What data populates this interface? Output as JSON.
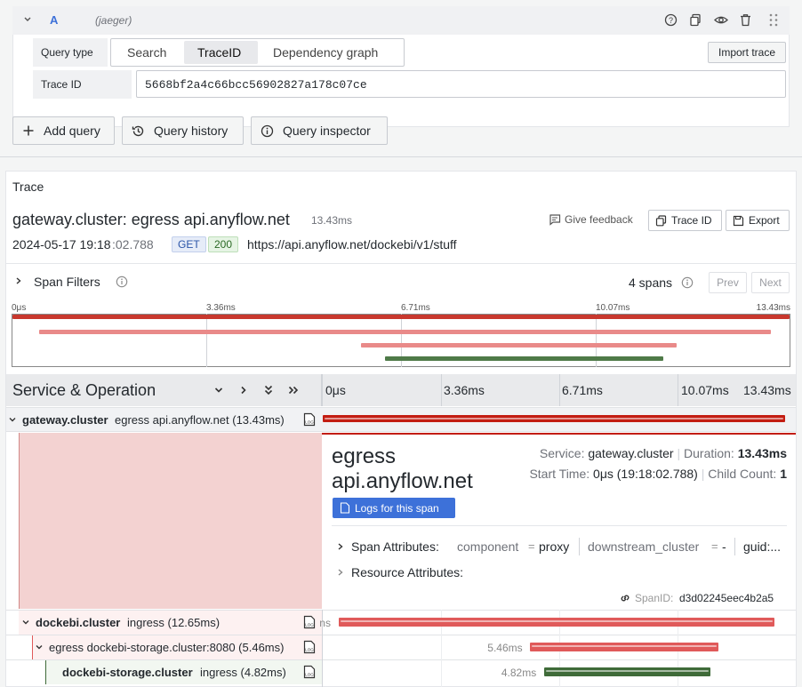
{
  "query_editor": {
    "query_letter": "A",
    "datasource": "(jaeger)",
    "query_type_label": "Query type",
    "query_types": [
      "Search",
      "TraceID",
      "Dependency graph"
    ],
    "active_query_type": "TraceID",
    "import_trace_label": "Import trace",
    "trace_id_label": "Trace ID",
    "trace_id_value": "5668bf2a4c66bcc56902827a178c07ce"
  },
  "actions": {
    "add_query": "Add query",
    "query_history": "Query history",
    "query_inspector": "Query inspector"
  },
  "trace_panel": {
    "title": "Trace",
    "trace_name": "gateway.cluster: egress api.anyflow.net",
    "duration": "13.43ms",
    "give_feedback": "Give feedback",
    "trace_id_button": "Trace ID",
    "export_button": "Export",
    "timestamp_main": "2024-05-17 19:18",
    "timestamp_ms": ":02.788",
    "method": "GET",
    "status": "200",
    "url": "https://api.anyflow.net/dockebi/v1/stuff",
    "span_filters": "Span Filters",
    "span_count": "4 spans",
    "prev": "Prev",
    "next": "Next"
  },
  "minimap": {
    "ticks": [
      "0μs",
      "3.36ms",
      "6.71ms",
      "10.07ms",
      "13.43ms"
    ],
    "spans": [
      {
        "start": 0,
        "end": 1,
        "color": "#c8382e"
      },
      {
        "start": 0.034,
        "end": 0.976,
        "color": "#e98a89"
      },
      {
        "start": 0.449,
        "end": 0.855,
        "color": "#e98a89"
      },
      {
        "start": 0.479,
        "end": 0.838,
        "color": "#4f7a48"
      }
    ]
  },
  "timeline_header": {
    "title": "Service & Operation",
    "ticks": [
      "0μs",
      "3.36ms",
      "6.71ms",
      "10.07ms",
      "13.43ms"
    ]
  },
  "spans": [
    {
      "service": "gateway.cluster",
      "operation": "egress api.anyflow.net (13.43ms)",
      "start": 0,
      "end": 1,
      "color": "#c31d12",
      "label": ""
    },
    {
      "service": "dockebi.cluster",
      "operation": "ingress (12.65ms)",
      "start": 0.034,
      "end": 0.976,
      "color": "#e05a5a",
      "label": "ns"
    },
    {
      "service": "",
      "operation": "egress dockebi-storage.cluster:8080 (5.46ms)",
      "start": 0.449,
      "end": 0.855,
      "color": "#e05a5a",
      "label": "5.46ms"
    },
    {
      "service": "dockebi-storage.cluster",
      "operation": "ingress (4.82ms)",
      "start": 0.479,
      "end": 0.838,
      "color": "#3f6b39",
      "label": "4.82ms"
    }
  ],
  "span_detail": {
    "operation": "egress api.anyflow.net",
    "service_label": "Service:",
    "service": "gateway.cluster",
    "duration_label": "Duration:",
    "duration": "13.43ms",
    "start_time_label": "Start Time:",
    "start_time": "0μs (19:18:02.788)",
    "child_count_label": "Child Count:",
    "child_count": "1",
    "logs_button": "Logs for this span",
    "span_attributes_label": "Span Attributes:",
    "attr1_key": "component",
    "attr1_value": "proxy",
    "attr2_key": "downstream_cluster",
    "attr2_value": "-",
    "attr3_key": "guid:...",
    "resource_attributes_label": "Resource Attributes:",
    "span_id_label": "SpanID:",
    "span_id": "d3d02245eec4b2a5"
  }
}
